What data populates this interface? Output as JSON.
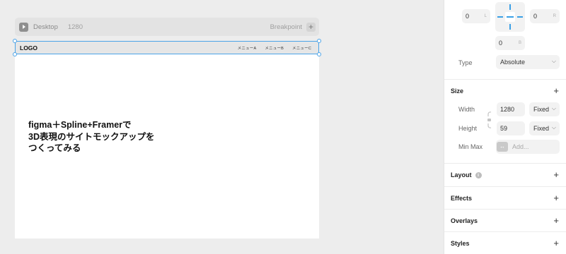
{
  "breakpoint_bar": {
    "name": "Desktop",
    "width": "1280",
    "label": "Breakpoint",
    "add_glyph": "+"
  },
  "frame": {
    "logo": "LOGO",
    "nav_links": [
      "メニューA",
      "メニューB",
      "メニューC"
    ],
    "hero_text": "figma＋Spline+Framerで\n3D表現のサイトモックアップを\nつくってみる"
  },
  "panel": {
    "position": {
      "left_value": "0",
      "left_sub": "L",
      "right_value": "0",
      "right_sub": "R",
      "bottom_value": "0",
      "bottom_sub": "B"
    },
    "type": {
      "label": "Type",
      "value": "Absolute"
    },
    "size": {
      "title": "Size",
      "width_label": "Width",
      "width_value": "1280",
      "width_mode": "Fixed",
      "height_label": "Height",
      "height_value": "59",
      "height_mode": "Fixed",
      "minmax_label": "Min Max",
      "minmax_placeholder": "Add..."
    },
    "sections": {
      "layout": "Layout",
      "effects": "Effects",
      "overlays": "Overlays",
      "styles": "Styles"
    },
    "plus_glyph": "+",
    "chevron_glyph": "⌵"
  },
  "colors": {
    "selection": "#4aa3e8",
    "canvas_bg": "#ededed",
    "panel_bg": "#ffffff"
  },
  "icons": [
    "play-icon",
    "plus-icon",
    "chevron-down-icon",
    "info-icon",
    "link-icon",
    "minmax-icon"
  ]
}
